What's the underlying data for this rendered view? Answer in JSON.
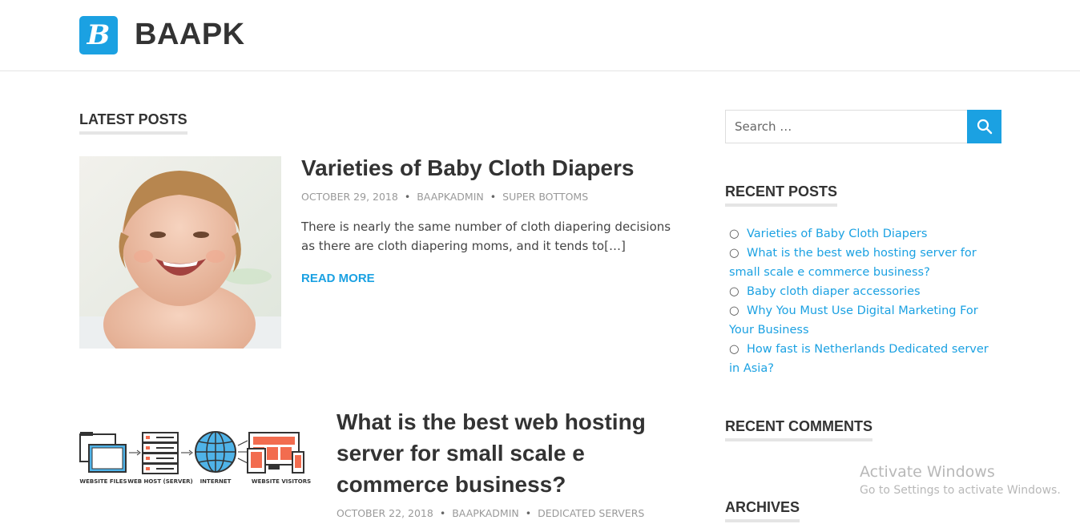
{
  "site": {
    "logo_letter": "B",
    "title": "BAAPK"
  },
  "main": {
    "section_title": "LATEST POSTS",
    "posts": [
      {
        "title": "Varieties of Baby Cloth Diapers",
        "date": "OCTOBER 29, 2018",
        "author": "BAAPKADMIN",
        "category": "SUPER BOTTOMS",
        "excerpt": "There is nearly the same number of cloth diapering decisions as there are cloth diapering moms, and it tends to[…]",
        "read_more": "READ MORE"
      },
      {
        "title": "What is the best web hosting server for small scale e commerce business?",
        "date": "OCTOBER 22, 2018",
        "author": "BAAPKADMIN",
        "category": "DEDICATED SERVERS",
        "diagram_labels": [
          "WEBSITE FILES",
          "WEB HOST (SERVER)",
          "INTERNET",
          "WEBSITE VISITORS"
        ]
      }
    ]
  },
  "sidebar": {
    "search_placeholder": "Search …",
    "recent_posts_title": "RECENT POSTS",
    "recent_posts": [
      "Varieties of Baby Cloth Diapers",
      "What is the best web hosting server for small scale e commerce business?",
      "Baby cloth diaper accessories",
      "Why You Must Use Digital Marketing For Your Business",
      "How fast is Netherlands Dedicated server in Asia?"
    ],
    "recent_comments_title": "RECENT COMMENTS",
    "archives_title": "ARCHIVES"
  },
  "overlay": {
    "activate_title": "Activate Windows",
    "activate_sub": "Go to Settings to activate Windows."
  },
  "colors": {
    "accent": "#1ba1e2",
    "text": "#333333",
    "meta": "#999999"
  },
  "icons": {
    "search": "search-icon",
    "logo": "logo-icon"
  }
}
